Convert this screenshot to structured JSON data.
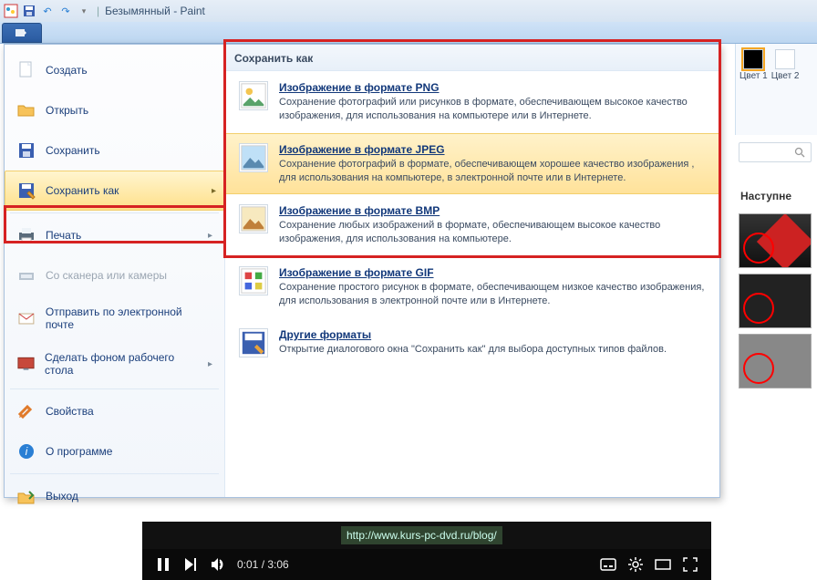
{
  "titlebar": {
    "title": "Безымянный - Paint"
  },
  "ribbon": {
    "color1_label": "Цвет 1",
    "color2_label": "Цвет 2"
  },
  "backstage": {
    "items": [
      {
        "label": "Создать",
        "underline": 0
      },
      {
        "label": "Открыть",
        "underline": 0
      },
      {
        "label": "Сохранить",
        "underline": 0
      },
      {
        "label": "Сохранить как",
        "underline": 10
      },
      {
        "label": "Печать",
        "underline": 0
      },
      {
        "label": "Со сканера или камеры",
        "underline": -1,
        "disabled": true
      },
      {
        "label": "Отправить по электронной почте",
        "underline": -1
      },
      {
        "label": "Сделать фоном рабочего стола",
        "underline": -1
      },
      {
        "label": "Свойства",
        "underline": 3
      },
      {
        "label": "О программе",
        "underline": -1
      },
      {
        "label": "Выход",
        "underline": 1
      }
    ]
  },
  "saveas": {
    "header": "Сохранить как",
    "formats": [
      {
        "title": "Изображение в формате PNG",
        "desc": "Сохранение фотографий или рисунков в формате, обеспечивающем высокое качество изображения, для использования на компьютере или в Интернете.",
        "icon": "PNG"
      },
      {
        "title": "Изображение в формате JPEG",
        "desc": "Сохранение фотографий в формате, обеспечивающем хорошее качество изображения , для использования на компьютере, в электронной почте или в Интернете.",
        "icon": "JPG",
        "hover": true
      },
      {
        "title": "Изображение в формате BMP",
        "desc": "Сохранение любых изображений в формате, обеспечивающем высокое качество изображения, для использования на компьютере.",
        "icon": "BMP"
      },
      {
        "title": "Изображение в формате GIF",
        "desc": "Сохранение простого рисунок в формате, обеспечивающем низкое качество изображения, для использования в электронной почте или в Интернете.",
        "icon": "GIF"
      },
      {
        "title": "Другие форматы",
        "desc": "Открытие диалогового окна \"Сохранить как\" для выбора доступных типов файлов.",
        "icon": "…"
      }
    ]
  },
  "sidebar": {
    "next_label": "Наступне"
  },
  "video": {
    "link": "http://www.kurs-pc-dvd.ru/blog/",
    "current_time": "0:01",
    "duration": "3:06"
  }
}
